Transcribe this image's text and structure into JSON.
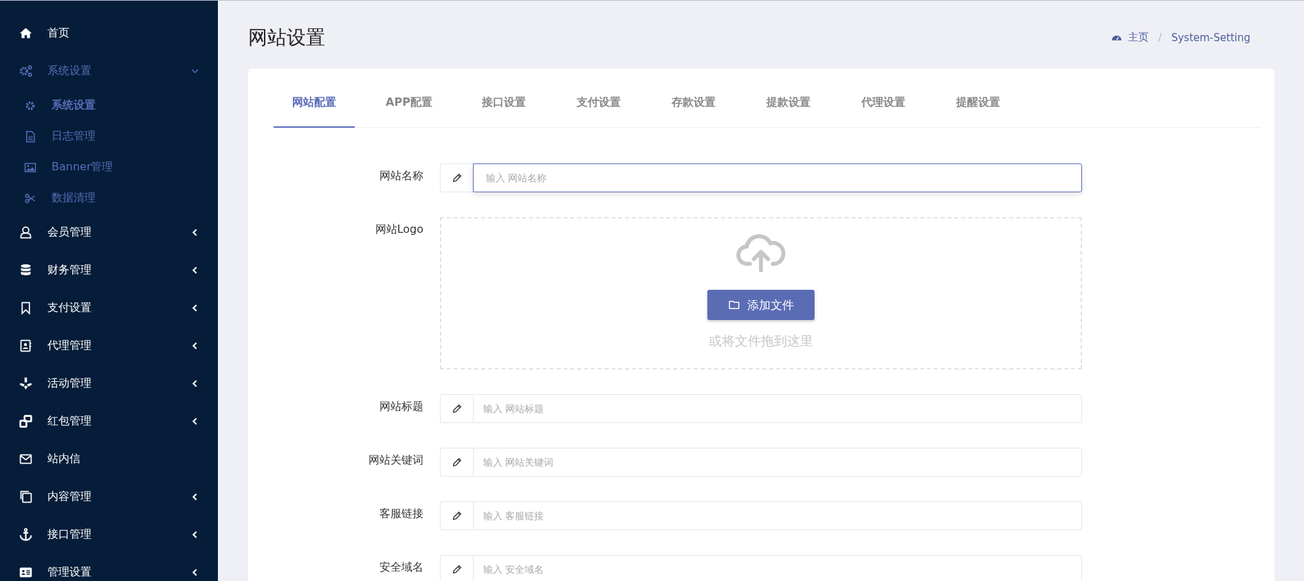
{
  "sidebar": {
    "items": [
      {
        "kind": "link",
        "label": "首页"
      },
      {
        "kind": "group",
        "label": "系统设置",
        "expanded": true,
        "children": [
          {
            "label": "系统设置",
            "selected": true
          },
          {
            "label": "日志管理",
            "selected": false
          },
          {
            "label": "Banner管理",
            "selected": false
          },
          {
            "label": "数据清理",
            "selected": false
          }
        ]
      },
      {
        "kind": "group",
        "label": "会员管理",
        "expanded": false
      },
      {
        "kind": "group",
        "label": "财务管理",
        "expanded": false
      },
      {
        "kind": "group",
        "label": "支付设置",
        "expanded": false
      },
      {
        "kind": "group",
        "label": "代理管理",
        "expanded": false
      },
      {
        "kind": "group",
        "label": "活动管理",
        "expanded": false
      },
      {
        "kind": "group",
        "label": "红包管理",
        "expanded": false
      },
      {
        "kind": "link",
        "label": "站内信"
      },
      {
        "kind": "group",
        "label": "内容管理",
        "expanded": false
      },
      {
        "kind": "group",
        "label": "接口管理",
        "expanded": false
      },
      {
        "kind": "group",
        "label": "管理设置",
        "expanded": false
      }
    ]
  },
  "page": {
    "title": "网站设置",
    "breadcrumb": [
      "主页",
      "System-Setting"
    ],
    "breadcrumb_separator": "/"
  },
  "tabs": [
    {
      "label": "网站配置",
      "selected": true
    },
    {
      "label": "APP配置",
      "selected": false
    },
    {
      "label": "接口设置",
      "selected": false
    },
    {
      "label": "支付设置",
      "selected": false
    },
    {
      "label": "存款设置",
      "selected": false
    },
    {
      "label": "提款设置",
      "selected": false
    },
    {
      "label": "代理设置",
      "selected": false
    },
    {
      "label": "提醒设置",
      "selected": false
    }
  ],
  "form": {
    "fields": [
      {
        "kind": "text",
        "label": "网站名称",
        "placeholder": "输入 网站名称",
        "focused": true
      },
      {
        "kind": "upload",
        "label": "网站Logo",
        "button": "添加文件",
        "hint": "或将文件拖到这里"
      },
      {
        "kind": "text",
        "label": "网站标题",
        "placeholder": "输入 网站标题",
        "focused": false
      },
      {
        "kind": "text",
        "label": "网站关键词",
        "placeholder": "输入 网站关键词",
        "focused": false
      },
      {
        "kind": "text",
        "label": "客服链接",
        "placeholder": "输入 客服链接",
        "focused": false
      },
      {
        "kind": "text",
        "label": "安全域名",
        "placeholder": "输入 安全域名",
        "focused": false
      }
    ]
  }
}
